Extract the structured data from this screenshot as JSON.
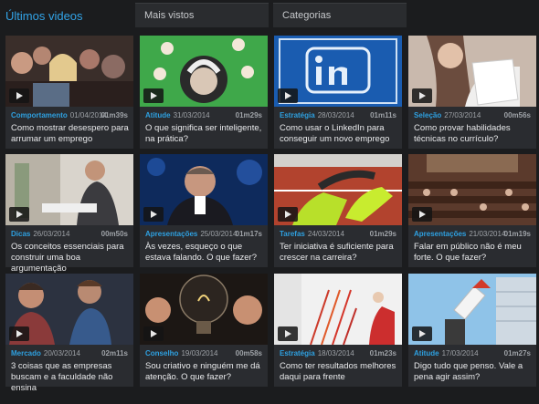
{
  "tabs": [
    {
      "label": "Últimos videos"
    },
    {
      "label": "Mais vistos"
    },
    {
      "label": "Categorias"
    }
  ],
  "colors": {
    "accent": "#32a4e8",
    "background": "#1b1c1e",
    "card": "#2a2c30"
  },
  "videos": [
    {
      "category": "Comportamento",
      "date": "01/04/2014",
      "duration": "01m39s",
      "title": "Como mostrar desespero para arrumar um emprego"
    },
    {
      "category": "Atitude",
      "date": "31/03/2014",
      "duration": "01m29s",
      "title": "O que significa ser inteligente, na prática?"
    },
    {
      "category": "Estratégia",
      "date": "28/03/2014",
      "duration": "01m11s",
      "title": "Como usar o LinkedIn para conseguir um novo emprego"
    },
    {
      "category": "Seleção",
      "date": "27/03/2014",
      "duration": "00m56s",
      "title": "Como provar habilidades técnicas no currículo?"
    },
    {
      "category": "Dicas",
      "date": "26/03/2014",
      "duration": "00m50s",
      "title": "Os conceitos essenciais para construir uma boa argumentação"
    },
    {
      "category": "Apresentações",
      "date": "25/03/2014",
      "duration": "01m17s",
      "title": "Às vezes, esqueço o que estava falando. O que fazer?"
    },
    {
      "category": "Tarefas",
      "date": "24/03/2014",
      "duration": "01m29s",
      "title": "Ter iniciativa é suficiente para crescer na carreira?"
    },
    {
      "category": "Apresentações",
      "date": "21/03/2014",
      "duration": "01m19s",
      "title": "Falar em público não é meu forte. O que fazer?"
    },
    {
      "category": "Mercado",
      "date": "20/03/2014",
      "duration": "02m11s",
      "title": "3 coisas que as empresas buscam e a faculdade não ensina"
    },
    {
      "category": "Conselho",
      "date": "19/03/2014",
      "duration": "00m58s",
      "title": "Sou criativo e ninguém me dá atenção. O que fazer?"
    },
    {
      "category": "Estratégia",
      "date": "18/03/2014",
      "duration": "01m23s",
      "title": "Como ter resultados melhores daqui para frente"
    },
    {
      "category": "Atitude",
      "date": "17/03/2014",
      "duration": "01m27s",
      "title": "Digo tudo que penso. Vale a pena agir assim?"
    }
  ]
}
